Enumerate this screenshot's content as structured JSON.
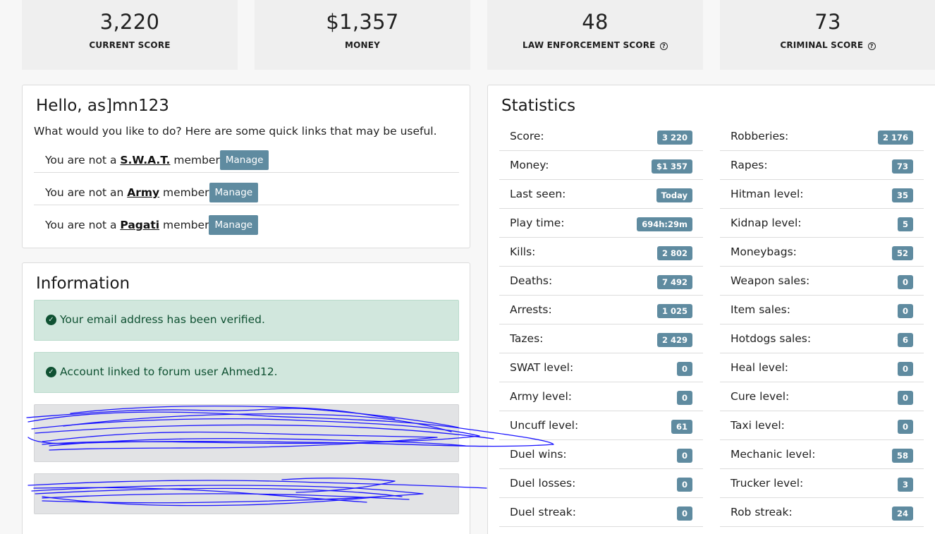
{
  "top_stats": [
    {
      "value": "3,220",
      "label": "CURRENT SCORE",
      "help": false
    },
    {
      "value": "$1,357",
      "label": "MONEY",
      "help": false
    },
    {
      "value": "48",
      "label": "LAW ENFORCEMENT SCORE",
      "help": true
    },
    {
      "value": "73",
      "label": "CRIMINAL SCORE",
      "help": true
    }
  ],
  "hello": {
    "title": "Hello, as]mn123",
    "intro": "What would you like to do? Here are some quick links that may be useful.",
    "memberships": [
      {
        "prefix": "You are not a ",
        "group": "S.W.A.T.",
        "suffix": " member",
        "button": "Manage"
      },
      {
        "prefix": "You are not an ",
        "group": "Army",
        "suffix": " member",
        "button": "Manage"
      },
      {
        "prefix": "You are not a ",
        "group": "Pagati",
        "suffix": " member",
        "button": "Manage"
      }
    ]
  },
  "information": {
    "title": "Information",
    "alerts": [
      "Your email address has been verified.",
      "Account linked to forum user Ahmed12."
    ]
  },
  "statistics": {
    "title": "Statistics",
    "left": [
      {
        "label": "Score:",
        "value": "3 220"
      },
      {
        "label": "Money:",
        "value": "$1 357"
      },
      {
        "label": "Last seen:",
        "value": "Today"
      },
      {
        "label": "Play time:",
        "value": "694h:29m"
      },
      {
        "label": "Kills:",
        "value": "2 802"
      },
      {
        "label": "Deaths:",
        "value": "7 492"
      },
      {
        "label": "Arrests:",
        "value": "1 025"
      },
      {
        "label": "Tazes:",
        "value": "2 429"
      },
      {
        "label": "SWAT level:",
        "value": "0"
      },
      {
        "label": "Army level:",
        "value": "0"
      },
      {
        "label": "Uncuff level:",
        "value": "61"
      },
      {
        "label": "Duel wins:",
        "value": "0"
      },
      {
        "label": "Duel losses:",
        "value": "0"
      },
      {
        "label": "Duel streak:",
        "value": "0"
      }
    ],
    "right": [
      {
        "label": "Robberies:",
        "value": "2 176"
      },
      {
        "label": "Rapes:",
        "value": "73"
      },
      {
        "label": "Hitman level:",
        "value": "35"
      },
      {
        "label": "Kidnap level:",
        "value": "5"
      },
      {
        "label": "Moneybags:",
        "value": "52"
      },
      {
        "label": "Weapon sales:",
        "value": "0"
      },
      {
        "label": "Item sales:",
        "value": "0"
      },
      {
        "label": "Hotdogs sales:",
        "value": "6"
      },
      {
        "label": "Heal level:",
        "value": "0"
      },
      {
        "label": "Cure level:",
        "value": "0"
      },
      {
        "label": "Taxi level:",
        "value": "0"
      },
      {
        "label": "Mechanic level:",
        "value": "58"
      },
      {
        "label": "Trucker level:",
        "value": "3"
      },
      {
        "label": "Rob streak:",
        "value": "24"
      }
    ]
  },
  "colors": {
    "badge": "#5f8ba0",
    "alert_bg": "#d1e7dd",
    "alert_text": "#0f5132",
    "scribble": "#1a14ff"
  }
}
